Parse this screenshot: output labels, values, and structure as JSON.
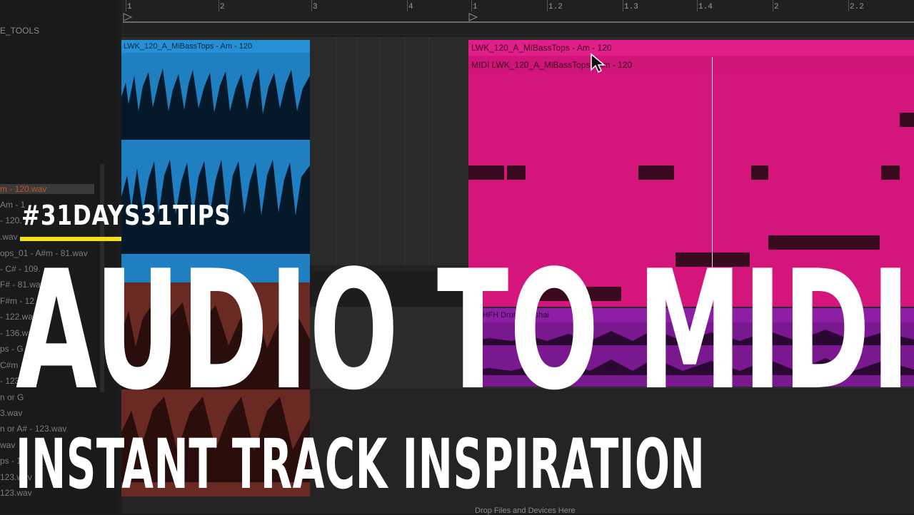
{
  "browser": {
    "section": "E_TOOLS",
    "items": [
      "m - 120.wav",
      "Am - 1",
      "- 120.",
      ".wav",
      "ops_01 - A#m - 81.wav",
      "- C# - 109.",
      "F# - 81.wav",
      "F#m - 12",
      "- 122.wav",
      "- 136.wav",
      "ps - G",
      "C#m",
      "- 123",
      "n or G",
      "3.wav",
      "n or A# - 123.wav",
      "wav",
      "ps - 12",
      "123.wav",
      "123.wav"
    ]
  },
  "ruler": {
    "left_ticks": [
      "1",
      "2",
      "3",
      "4"
    ],
    "right_ticks": [
      "1",
      "1.2",
      "1.3",
      "1.4",
      "2",
      "2.2"
    ]
  },
  "clips": {
    "audio_clip_name": "LWK_120_A_MiBassTops - Am - 120",
    "midi_clip_name_top": "LWK_120_A_MiBassTops - Am - 120",
    "midi_clip_name": "MIDI LWK_120_A_MiBassTops - Am - 120",
    "drum_clip_name": "S_HFH      Drum       dayshai"
  },
  "drop_hint": "Drop Files and Devices Here",
  "overlay": {
    "hashtag": "#31DAYS31TIPS",
    "title": "AUDIO TO MIDI",
    "subtitle": "INSTANT TRACK INSPIRATION"
  },
  "colors": {
    "audio_clip": "#1f7fc0",
    "midi_clip": "#d4157c",
    "drum_clip": "#7a1890",
    "accent_bar": "#f3e01c"
  }
}
